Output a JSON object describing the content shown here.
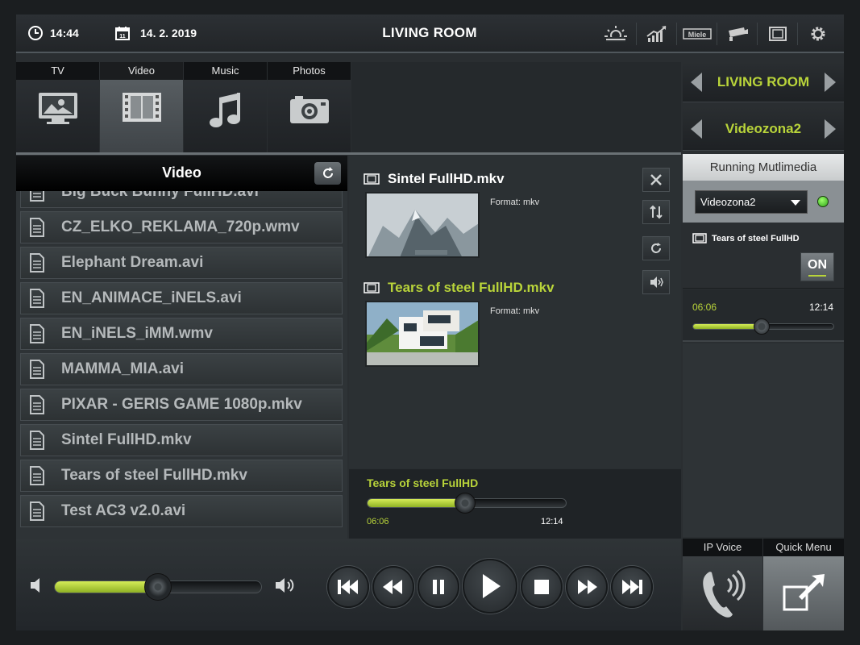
{
  "header": {
    "time": "14:44",
    "date": "14. 2. 2019",
    "title": "LIVING ROOM",
    "calendar_day": "11",
    "icons": [
      "weather-icon",
      "chart-icon",
      "miele-icon",
      "camera-icon",
      "film-icon",
      "gear-icon"
    ],
    "miele_label": "Miele"
  },
  "tabs": [
    {
      "label": "TV",
      "icon": "tv-icon"
    },
    {
      "label": "Video",
      "icon": "film-icon",
      "active": true
    },
    {
      "label": "Music",
      "icon": "music-note-icon"
    },
    {
      "label": "Photos",
      "icon": "camera-icon"
    }
  ],
  "video_list": {
    "title": "Video",
    "items": [
      "Big Buck Bunny FullHD.avi",
      "CZ_ELKO_REKLAMA_720p.wmv",
      "Elephant Dream.avi",
      "EN_ANIMACE_iNELS.avi",
      "EN_iNELS_iMM.wmv",
      "MAMMA_MIA.avi",
      "PIXAR - GERIS GAME 1080p.mkv",
      "Sintel FullHD.mkv",
      "Tears of steel FullHD.mkv",
      "Test AC3 v2.0.avi"
    ]
  },
  "detail": {
    "files": [
      {
        "name": "Sintel FullHD.mkv",
        "format": "Format: mkv",
        "highlight": false
      },
      {
        "name": "Tears of steel FullHD.mkv",
        "format": "Format: mkv",
        "highlight": true
      }
    ]
  },
  "now_playing": {
    "title": "Tears of steel FullHD",
    "elapsed": "06:06",
    "total": "12:14",
    "progress": 0.49
  },
  "volume": {
    "level": 0.5
  },
  "right_panel": {
    "room": "LIVING ROOM",
    "zone": "Videozona2",
    "running_title": "Running Mutlimedia",
    "selected_zone": "Videozona2",
    "media_title": "Tears of steel FullHD",
    "on_label": "ON",
    "elapsed": "06:06",
    "total": "12:14",
    "progress": 0.49
  },
  "quick": {
    "ip_voice": "IP Voice",
    "quick_menu": "Quick Menu"
  },
  "colors": {
    "accent": "#b9d43a",
    "background": "#2a2e31",
    "led": "#4cd12a"
  }
}
